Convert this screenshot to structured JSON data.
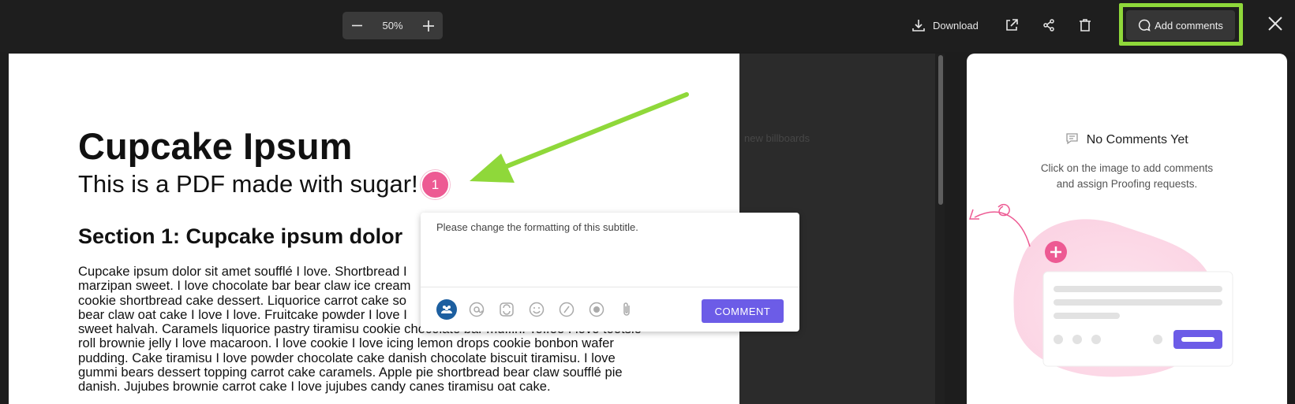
{
  "toolbar": {
    "zoom_level": "50%",
    "download_label": "Download",
    "add_comments_label": "Add comments",
    "highlight_color": "#8fd83a"
  },
  "document": {
    "title": "Cupcake Ipsum",
    "subtitle": "This is a PDF made with sugar!",
    "section_heading": "Section 1: Cupcake ipsum dolor",
    "body_lines": [
      "Cupcake ipsum dolor sit amet soufflé I love. Shortbread I",
      "marzipan sweet. I love chocolate bar bear claw ice cream",
      "cookie shortbread cake dessert. Liquorice carrot cake so",
      "bear claw oat cake I love I love. Fruitcake powder I love I",
      "sweet halvah. Caramels liquorice pastry tiramisu cookie chocolate bar muffin. Toffee I love tootsie",
      "roll brownie jelly I love macaroon. I love cookie I love icing lemon drops cookie bonbon wafer",
      "pudding. Cake tiramisu I love powder chocolate cake danish chocolate biscuit tiramisu. I love",
      "gummi bears dessert topping carrot cake caramels. Apple pie shortbread bear claw soufflé pie",
      "danish. Jujubes brownie carrot cake I love jujubes candy canes tiramisu oat cake."
    ]
  },
  "background_ghost": {
    "line1": "new billboards"
  },
  "annotation": {
    "pin_number": "1",
    "comment_text": "Please change the formatting of this subtitle.",
    "comment_button": "COMMENT",
    "accent_color": "#6c5ce7",
    "pin_color": "#ed5a93"
  },
  "comments_panel": {
    "empty_title": "No Comments Yet",
    "empty_desc_line1": "Click on the image to add comments",
    "empty_desc_line2": "and assign Proofing requests."
  },
  "icons": [
    "minus-icon",
    "plus-icon",
    "download-icon",
    "external-link-icon",
    "share-icon",
    "trash-icon",
    "comment-icon",
    "close-icon",
    "team-icon",
    "mention-icon",
    "attach-icon",
    "emoji-icon",
    "slash-icon",
    "record-icon",
    "paperclip-icon"
  ]
}
